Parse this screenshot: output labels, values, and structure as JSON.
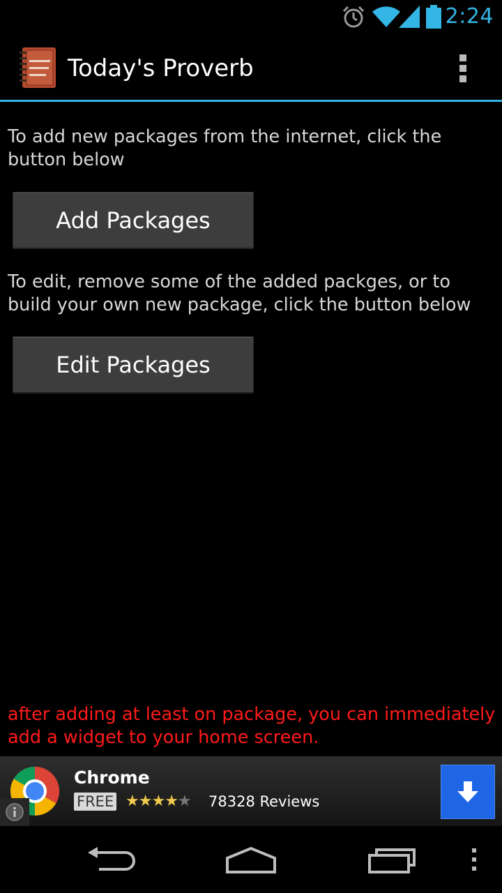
{
  "status_bar": {
    "time": "2:24",
    "icons": [
      "alarm-icon",
      "wifi-icon",
      "signal-icon",
      "battery-icon"
    ],
    "accent_color": "#33b5e5"
  },
  "action_bar": {
    "title": "Today's Proverb",
    "app_icon": "notebook-icon",
    "overflow_icon": "overflow-menu-icon"
  },
  "main": {
    "add_info": "To add new packages from the internet, click the button below",
    "add_button": "Add Packages",
    "edit_info": "To edit, remove some of the added packges, or to build your own new package, click the button below",
    "edit_button": "Edit Packages",
    "widget_note": "after adding at least on package, you can immediately add a widget to your home screen.",
    "widget_note_color": "#ff1a1a"
  },
  "ad": {
    "title": "Chrome",
    "price": "FREE",
    "rating": 4,
    "rating_max": 5,
    "reviews": "78328 Reviews",
    "download_color": "#1e66e6"
  },
  "nav_bar": {
    "icons": [
      "back-icon",
      "home-icon",
      "recent-apps-icon",
      "menu-icon"
    ]
  }
}
